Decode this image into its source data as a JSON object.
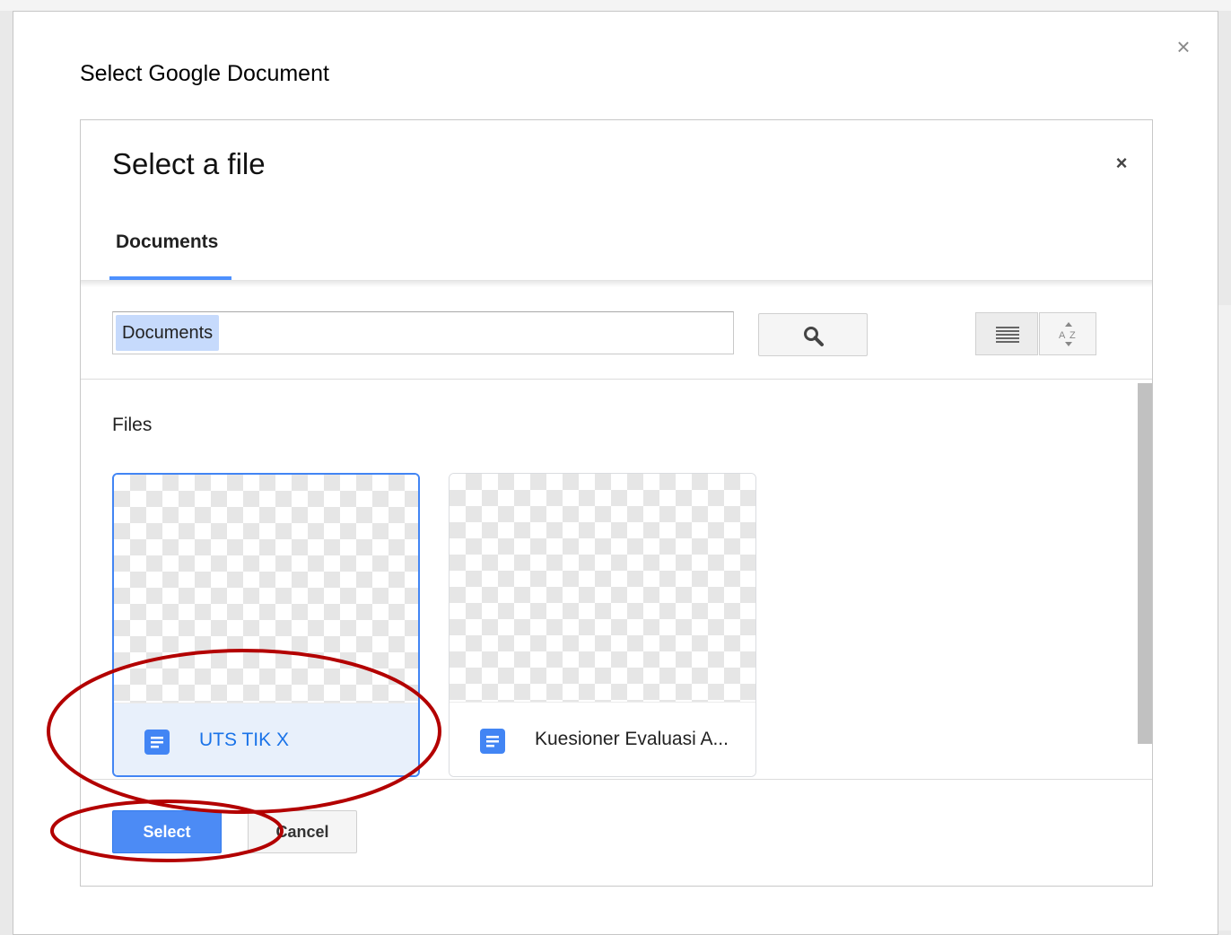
{
  "dialog": {
    "title": "Select Google Document",
    "close_glyph": "×"
  },
  "picker": {
    "title": "Select a file",
    "close_glyph": "×",
    "tabs": [
      {
        "label": "Documents",
        "active": true
      }
    ],
    "search": {
      "token": "Documents",
      "button_icon": "search-icon"
    },
    "view_controls": {
      "list_view_icon": "list-view-icon",
      "sort_icon": "sort-az-icon"
    },
    "section_label": "Files",
    "files": [
      {
        "name": "UTS TIK X",
        "icon": "google-docs-icon",
        "selected": true
      },
      {
        "name": "Kuesioner Evaluasi A...",
        "icon": "google-docs-icon",
        "selected": false
      }
    ],
    "buttons": {
      "select_label": "Select",
      "cancel_label": "Cancel"
    }
  },
  "colors": {
    "accent_blue": "#4285f4",
    "select_button": "#4c8bf5",
    "annotation_red": "#b30000"
  }
}
